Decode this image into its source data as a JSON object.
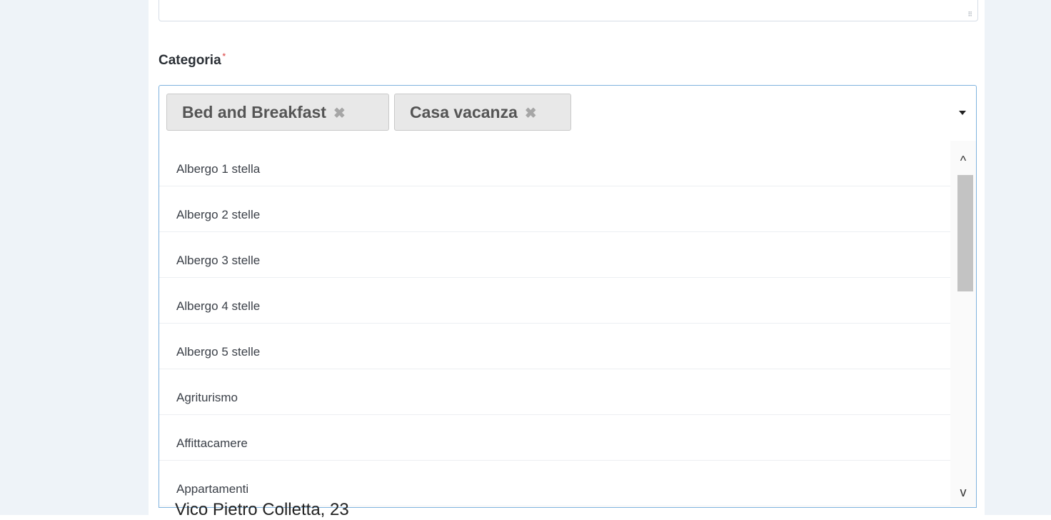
{
  "field": {
    "label": "Categoria",
    "required_marker": "*"
  },
  "selected_tags": [
    {
      "label": "Bed and Breakfast",
      "remove": "✖"
    },
    {
      "label": "Casa vacanza",
      "remove": "✖"
    }
  ],
  "options": [
    "Albergo 1 stella",
    "Albergo 2 stelle",
    "Albergo 3 stelle",
    "Albergo 4 stelle",
    "Albergo 5 stelle",
    "Agriturismo",
    "Affittacamere",
    "Appartamenti"
  ],
  "scroll": {
    "up": "^",
    "down": "v"
  },
  "below_field_value": "Vico Pietro Colletta, 23"
}
